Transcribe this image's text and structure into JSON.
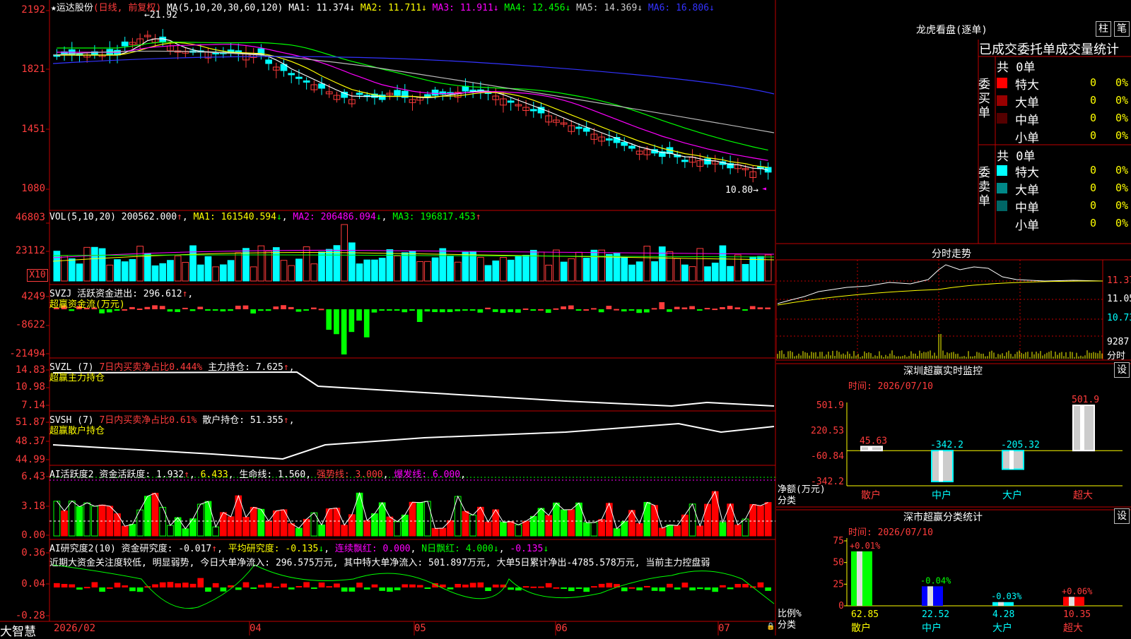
{
  "chart": {
    "stock": "运达股份",
    "mode": "(日线, 前复权)",
    "ma_label": "MA(5,10,20,30,60,120)",
    "ma_values": [
      {
        "name": "MA1",
        "value": "11.374",
        "color": "#ffffff"
      },
      {
        "name": "MA2",
        "value": "11.711",
        "color": "#ffff00"
      },
      {
        "name": "MA3",
        "value": "11.911",
        "color": "#ff00ff"
      },
      {
        "name": "MA4",
        "value": "12.456",
        "color": "#00ff00"
      },
      {
        "name": "MA5",
        "value": "14.369",
        "color": "#cccccc"
      },
      {
        "name": "MA6",
        "value": "16.806",
        "color": "#3333ff"
      }
    ],
    "high_label": "21.92",
    "low_label": "10.80",
    "y_ticks": [
      "2192",
      "1821",
      "1451",
      "1080"
    ],
    "x_ticks": [
      "2026/02",
      "04",
      "05",
      "06",
      "07"
    ],
    "brand": "大智慧"
  },
  "vol": {
    "label": "VOL(5,10,20)",
    "value": "200562.000",
    "ma1": "161540.594",
    "ma2": "206486.094",
    "ma3": "196817.453",
    "y_ticks": [
      "46803",
      "23112"
    ],
    "unit": "X10"
  },
  "svzj": {
    "label": "SVZJ",
    "text": "活跃资金进出: 296.612",
    "subtitle": "超赢资金流(万元)",
    "y_ticks": [
      "4249",
      "-8622",
      "-21494"
    ]
  },
  "svzl": {
    "label": "SVZL (7)",
    "text1": "7日内买卖净占比0.444%",
    "text2": "主力持仓: 7.625",
    "subtitle": "超赢主力持仓",
    "y_ticks": [
      "14.83",
      "10.98",
      "7.14"
    ]
  },
  "svsh": {
    "label": "SVSH (7)",
    "text1": "7日内买卖净占比0.61%",
    "text2": "散户持仓: 51.355",
    "subtitle": "超赢散户持仓",
    "y_ticks": [
      "51.87",
      "48.37",
      "44.99"
    ]
  },
  "ai1": {
    "label": "AI活跃度2",
    "text1": "资金活跃度: 1.932",
    "text1b": "6.433",
    "text2": "生命线: 1.560",
    "text3": "强势线: 3.000",
    "text4": "爆发线: 6.000",
    "y_ticks": [
      "6.43",
      "3.18",
      "0.00"
    ]
  },
  "ai2": {
    "label": "AI研究度2(10)",
    "text1": "资金研究度: -0.017",
    "text2": "平均研究度: -0.135",
    "text3": "连续飘红: 0.000",
    "text4": "N日飘红: 4.000",
    "text5": "-0.135",
    "desc": "近期大资金关注度较低, 明显弱势, 今日大单净流入: 296.575万元, 其中特大单净流入: 501.897万元, 大单5日累计净出-4785.578万元, 当前主力控盘弱",
    "y_ticks": [
      "0.36",
      "0.04",
      "-0.28"
    ]
  },
  "lhb": {
    "title": "龙虎看盘(逐单)",
    "btn1": "柱",
    "btn2": "笔",
    "header": "已成交委托单成交量统计",
    "buy_label": "委买单",
    "sell_label": "委卖单",
    "buy_total": "共 0单",
    "sell_total": "共 0单",
    "buy_rows": [
      {
        "name": "特大",
        "count": "0",
        "pct": "0%",
        "color": "#ff0000"
      },
      {
        "name": "大单",
        "count": "0",
        "pct": "0%",
        "color": "#990000"
      },
      {
        "name": "中单",
        "count": "0",
        "pct": "0%",
        "color": "#550000"
      },
      {
        "name": "小单",
        "count": "0",
        "pct": "0%",
        "color": ""
      }
    ],
    "sell_rows": [
      {
        "name": "特大",
        "count": "0",
        "pct": "0%",
        "color": "#00ffff"
      },
      {
        "name": "大单",
        "count": "0",
        "pct": "0%",
        "color": "#008888"
      },
      {
        "name": "中单",
        "count": "0",
        "pct": "0%",
        "color": "#006666"
      },
      {
        "name": "小单",
        "count": "0",
        "pct": "0%",
        "color": ""
      }
    ]
  },
  "fenshi": {
    "title": "分时走势",
    "p1": "11.37",
    "p2": "11.05",
    "p3": "10.73",
    "vol": "9287",
    "vol_label": "分时"
  },
  "sz_monitor": {
    "title": "深圳超赢实时监控",
    "btn": "设",
    "time": "时间: 2026/07/10",
    "y_ticks": [
      "501.9",
      "220.53",
      "-60.84",
      "-342.2"
    ],
    "axis_label1": "净额(万元)",
    "axis_label2": "分类",
    "categories": [
      "散户",
      "中户",
      "大户",
      "超大"
    ],
    "values": [
      45.63,
      -342.2,
      -205.32,
      501.9
    ],
    "value_labels": [
      "45.63",
      "-342.2",
      "-205.32",
      "501.9"
    ]
  },
  "sz_class": {
    "title": "深市超赢分类统计",
    "btn": "设",
    "time": "时间: 2026/07/10",
    "y_ticks": [
      "75",
      "50",
      "25",
      "0"
    ],
    "axis_label1": "比例%",
    "axis_label2": "分类",
    "categories": [
      "散户",
      "中户",
      "大户",
      "超大"
    ],
    "values": [
      62.85,
      22.52,
      4.28,
      10.35
    ],
    "value_labels": [
      "62.85",
      "22.52",
      "4.28",
      "10.35"
    ],
    "change_labels": [
      "+0.01%",
      "-0.04%",
      "-0.03%",
      "+0.06%"
    ]
  }
}
